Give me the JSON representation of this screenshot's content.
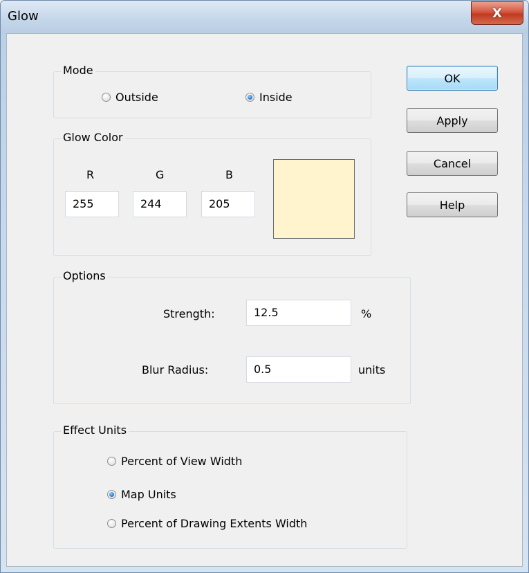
{
  "window": {
    "title": "Glow",
    "close_glyph": "X"
  },
  "mode": {
    "legend": "Mode",
    "options": [
      {
        "label": "Outside",
        "checked": false
      },
      {
        "label": "Inside",
        "checked": true
      }
    ]
  },
  "glow_color": {
    "legend": "Glow Color",
    "r_label": "R",
    "g_label": "G",
    "b_label": "B",
    "r": "255",
    "g": "244",
    "b": "205",
    "swatch_color": "#fff4cd"
  },
  "options": {
    "legend": "Options",
    "strength_label": "Strength:",
    "strength_value": "12.5",
    "strength_unit": "%",
    "blur_label": "Blur Radius:",
    "blur_value": "0.5",
    "blur_unit": "units"
  },
  "effect_units": {
    "legend": "Effect Units",
    "options": [
      {
        "label": "Percent of View Width",
        "checked": false
      },
      {
        "label": "Map Units",
        "checked": true
      },
      {
        "label": "Percent of Drawing Extents Width",
        "checked": false
      }
    ]
  },
  "buttons": {
    "ok": "OK",
    "apply": "Apply",
    "cancel": "Cancel",
    "help": "Help"
  }
}
